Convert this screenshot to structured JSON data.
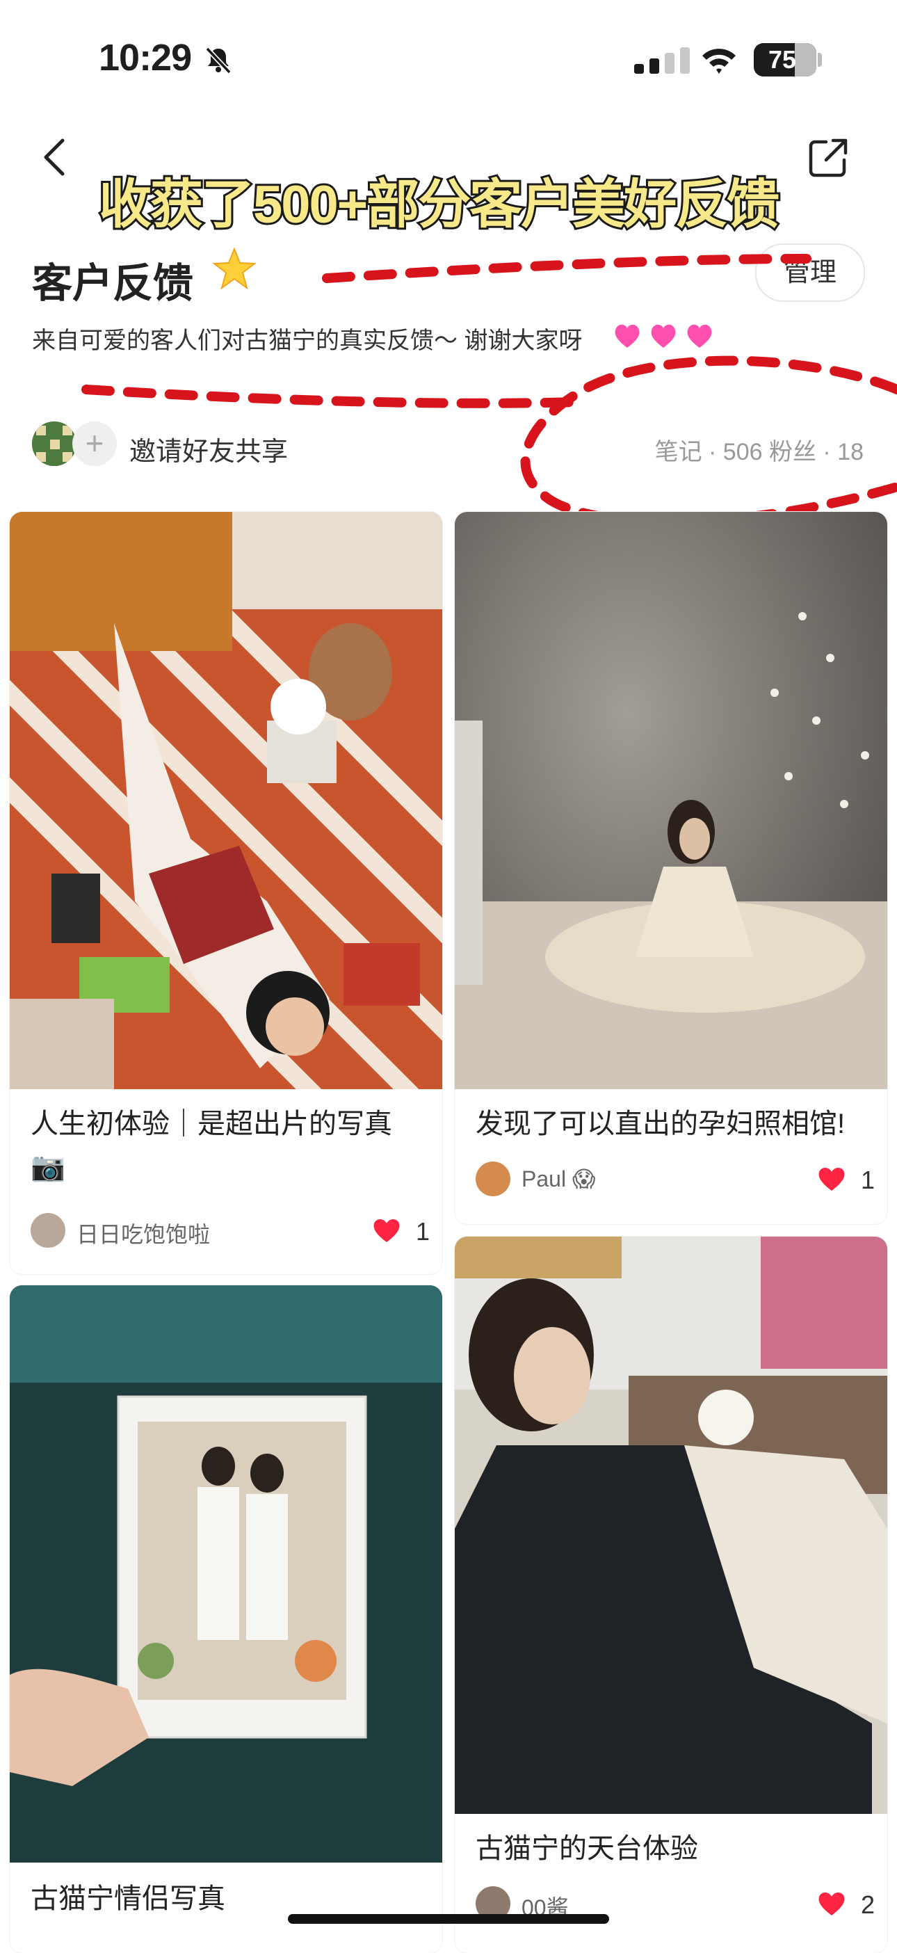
{
  "status_bar": {
    "time": "10:29",
    "battery": "75"
  },
  "banner": {
    "text": "收获了500+部分客户美好反馈"
  },
  "board": {
    "title": "客户反馈",
    "manage_label": "管理",
    "description": "来自可爱的客人们对古猫宁的真实反馈～ 谢谢大家呀",
    "invite_label": "邀请好友共享",
    "stats": "笔记 · 506    粉丝 · 18"
  },
  "cards": [
    {
      "title": "人生初体验｜是超出片的写真",
      "title_line2": "📷",
      "user": "日日吃饱饱啦",
      "likes": "1"
    },
    {
      "title": "发现了可以直出的孕妇照相馆!",
      "user": "Paul 😱",
      "likes": "1"
    },
    {
      "title": "古猫宁情侣写真",
      "user": "",
      "likes": ""
    },
    {
      "title": "古猫宁的天台体验",
      "user": "00酱",
      "likes": "2"
    }
  ],
  "colors": {
    "annotation_red": "#d7141b",
    "like_red": "#ff2442",
    "banner_yellow": "#f7e88a"
  }
}
